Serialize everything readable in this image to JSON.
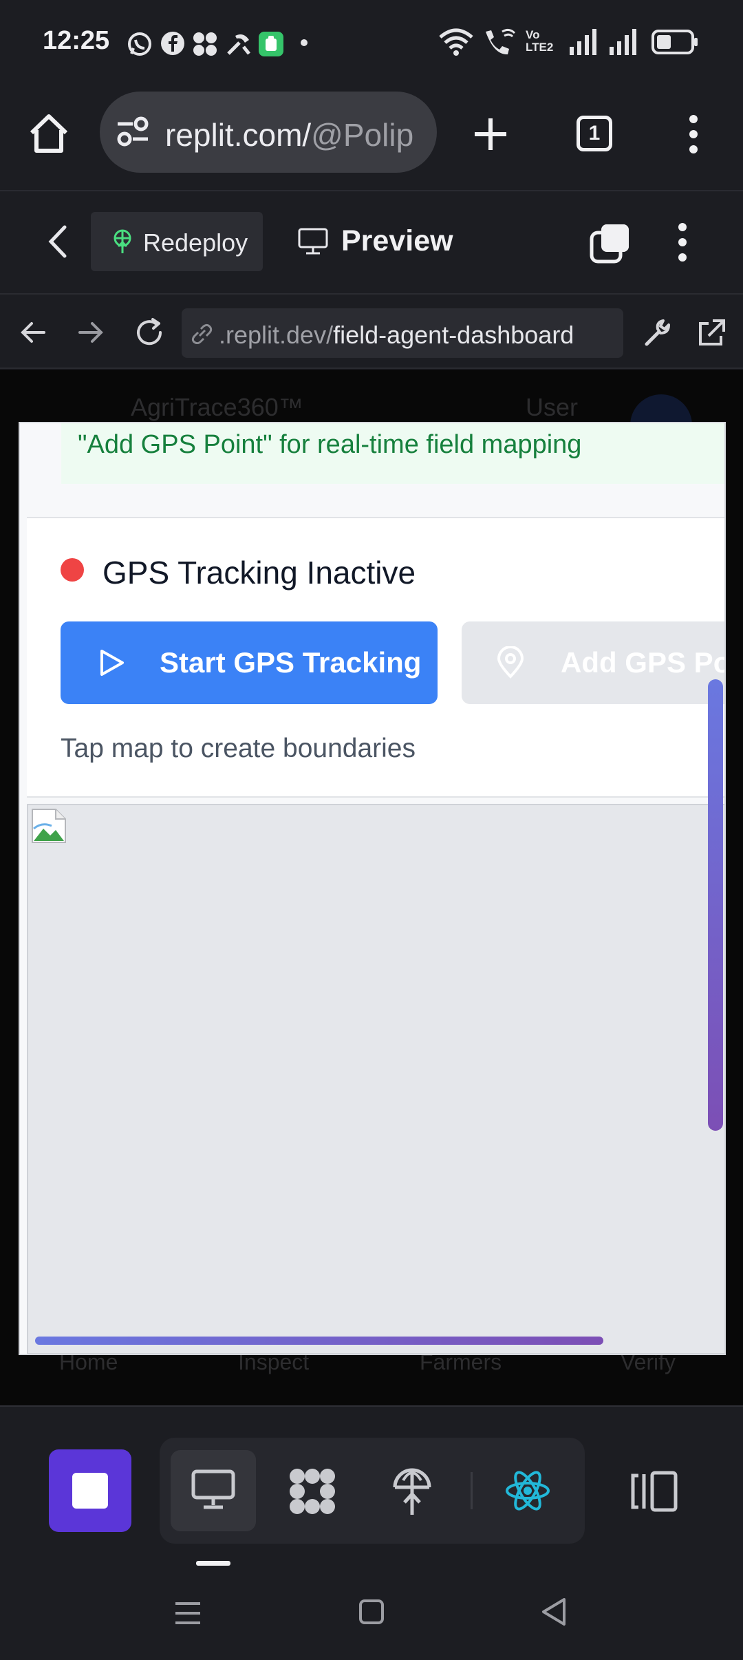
{
  "status_bar": {
    "time": "12:25",
    "left_icons": [
      "whatsapp-icon",
      "facebook-icon",
      "app-icon",
      "tools-icon",
      "notification-app-icon",
      "dot-icon"
    ],
    "right_icons": [
      "wifi-icon",
      "wifi-calling-icon",
      "volte-icon",
      "signal-icon",
      "signal-icon",
      "battery-icon"
    ],
    "volte_label": "Vo LTE2"
  },
  "browser": {
    "url_host": "replit.com/",
    "url_path": "@Polip",
    "tab_count": "1"
  },
  "replit_header": {
    "redeploy_label": "Redeploy",
    "preview_label": "Preview"
  },
  "devtools_nav": {
    "url_host": ".replit.dev/",
    "url_path": "field-agent-dashboard"
  },
  "background_page": {
    "app_name": "AgriTrace360™",
    "user_label": "User",
    "nav_items": [
      "Home",
      "Inspect",
      "Farmers",
      "Verify"
    ]
  },
  "app": {
    "banner_text": "\"Add GPS Point\" for real-time field mapping",
    "gps_status": "GPS Tracking Inactive",
    "start_button": "Start GPS Tracking",
    "add_button": "Add GPS Po",
    "hint": "Tap map to create boundaries",
    "colors": {
      "status_inactive": "#ef4444",
      "primary": "#3b82f6",
      "disabled": "#e5e7eb",
      "banner_text": "#16803d"
    }
  },
  "bottom_toolbar": {
    "icons": [
      "stop-icon",
      "preview-icon",
      "extensions-icon",
      "deploy-icon",
      "react-icon",
      "panels-icon"
    ]
  },
  "android_nav": {
    "icons": [
      "menu-icon",
      "home-icon",
      "back-icon"
    ]
  }
}
